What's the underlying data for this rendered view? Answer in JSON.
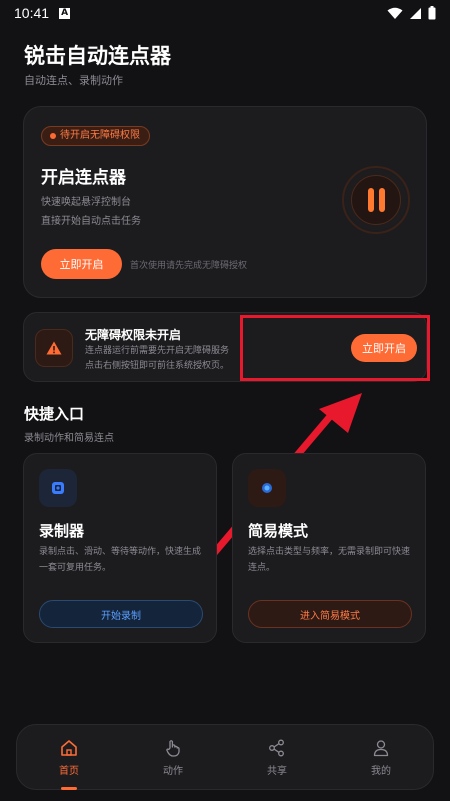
{
  "status_bar": {
    "time": "10:41",
    "a_icon": "A"
  },
  "header": {
    "title": "锐击自动连点器",
    "subtitle": "自动连点、录制动作"
  },
  "hero": {
    "badge": "待开启无障碍权限",
    "title": "开启连点器",
    "desc_line1": "快速唤起悬浮控制台",
    "desc_line2": "直接开始自动点击任务",
    "button": "立即开启",
    "note": "首次使用请先完成无障碍授权"
  },
  "permission": {
    "title": "无障碍权限未开启",
    "desc_line1": "连点器运行前需要先开启无障碍服务",
    "desc_line2": "点击右侧按钮即可前往系统授权页。",
    "button": "立即开启"
  },
  "quick": {
    "title": "快捷入口",
    "subtitle": "录制动作和简易连点"
  },
  "recorder": {
    "title": "录制器",
    "desc": "录制点击、滑动、等待等动作，快速生成一套可复用任务。",
    "button": "开始录制"
  },
  "simple": {
    "title": "简易模式",
    "desc": "选择点击类型与频率，无需录制即可快速连点。",
    "button": "进入简易模式"
  },
  "nav": [
    {
      "label": "首页",
      "icon": "home-icon",
      "active": true
    },
    {
      "label": "动作",
      "icon": "hand-pointer-icon",
      "active": false
    },
    {
      "label": "共享",
      "icon": "share-icon",
      "active": false
    },
    {
      "label": "我的",
      "icon": "user-icon",
      "active": false
    }
  ],
  "colors": {
    "accent": "#ff6b35",
    "highlight": "#e8192c",
    "background": "#121214",
    "card": "#1c1c1f",
    "blue": "#5aa0ff"
  }
}
